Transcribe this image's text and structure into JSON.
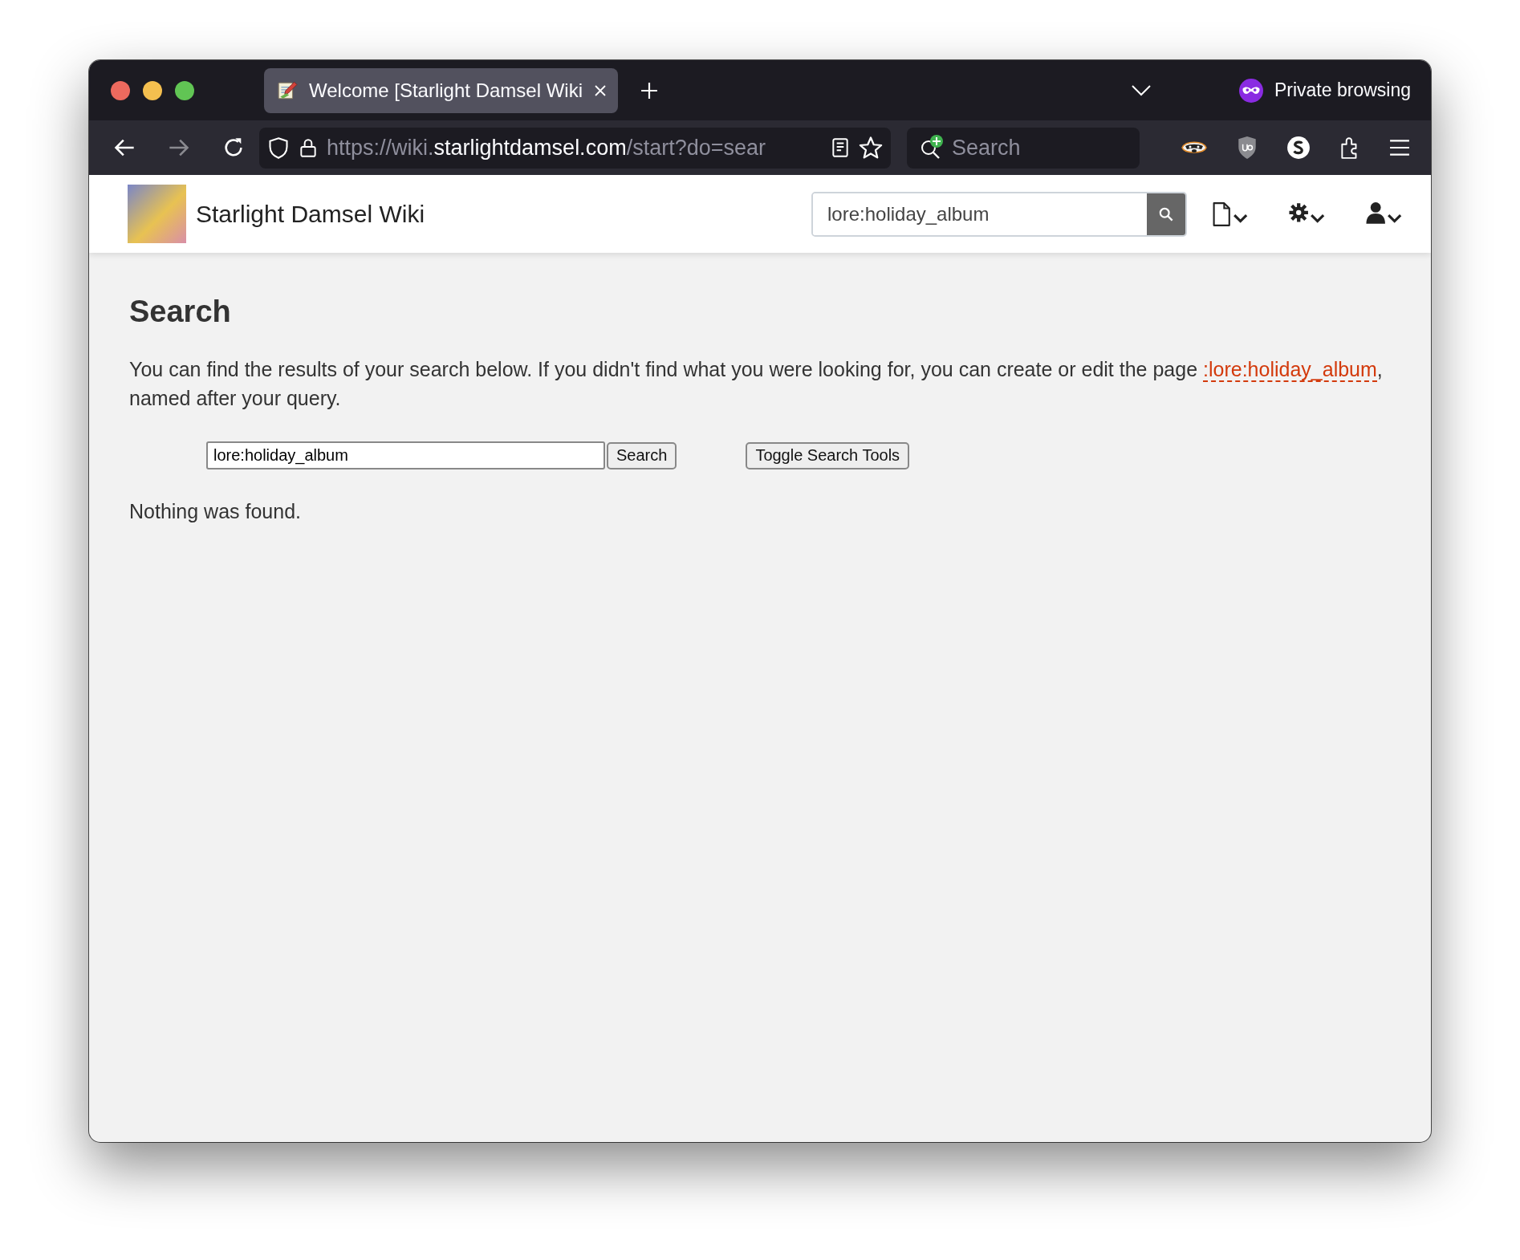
{
  "browser": {
    "tab": {
      "title": "Welcome [Starlight Damsel Wiki",
      "selected": true
    },
    "private_label": "Private browsing",
    "url": {
      "scheme": "https://wiki.",
      "domain": "starlightdamsel.com",
      "path": "/start?do=sear"
    },
    "search_placeholder": "Search"
  },
  "site": {
    "title": "Starlight Damsel Wiki",
    "search_value": "lore:holiday_album"
  },
  "page": {
    "heading": "Search",
    "intro": "You can find the results of your search below. If you didn't find what you were looking for, you can create or edit the page ",
    "link": ":lore:holiday_album",
    "intro_end": ", named after your query.",
    "query": "lore:holiday_album",
    "search_button": "Search",
    "toggle_button": "Toggle Search Tools",
    "result": "Nothing was found."
  }
}
